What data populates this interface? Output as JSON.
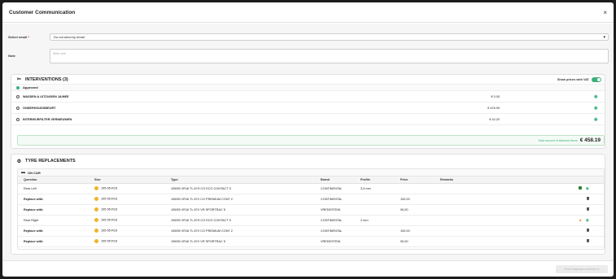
{
  "modal": {
    "title": "Customer Communication",
    "close_icon": "×"
  },
  "form": {
    "select_email_label": "Select email",
    "required_mark": "*",
    "select_email_value": "Do not send by email",
    "note_label": "Note",
    "note_placeholder": "Write note"
  },
  "interventions": {
    "title": "INTERVENTIONS (3)",
    "vat_label": "Show prices with VAT",
    "vat_on": true,
    "approved_label": "Approved",
    "items": [
      {
        "name": "WASSEN & UITZUIGEN JA/NEE",
        "price": "€ 0.00"
      },
      {
        "name": "ONDERHOUDSBEURT",
        "price": "€ 415.99"
      },
      {
        "name": "INTERIEURFILTER VERNIEUWEN",
        "price": "€ 42.20"
      }
    ],
    "total_label": "Total amount of selected items",
    "total_value": "€ 458.19"
  },
  "tyres": {
    "title": "TYRE REPLACEMENTS",
    "sub_title": "ON CAR",
    "columns": [
      "Question",
      "Size",
      "Type",
      "Brand",
      "Profile",
      "Price",
      "Remarks"
    ],
    "rows": [
      {
        "question": "Rear Left",
        "size": "195-55-R16",
        "type": "195/55 VR16 TL 87H CO ECO CONTACT 5",
        "brand": "CONTINENTAL",
        "profile": "3,3 mm",
        "price": "",
        "remarks": "",
        "bold": false,
        "icons": [
          "comment",
          "eye"
        ]
      },
      {
        "question": "Replace with:",
        "size": "195-55-R16",
        "type": "195/55 VR16 TL 87V CO PREMIUM CONT 2",
        "brand": "CONTINENTAL",
        "profile": "",
        "price": "100,00",
        "remarks": "",
        "bold": true,
        "icons": [
          "trash"
        ]
      },
      {
        "question": "Replace with:",
        "size": "195-55-R16",
        "type": "195/55 VR16 TL 87V VR SPORTRAC 5",
        "brand": "VREDESTEIN",
        "profile": "",
        "price": "90,00",
        "remarks": "",
        "bold": true,
        "icons": [
          "trash"
        ]
      },
      {
        "question": "Rear Right",
        "size": "195-55-R16",
        "type": "195/55 VR16 TL 87H CO ECO CONTACT 5",
        "brand": "CONTINENTAL",
        "profile": "2 mm",
        "price": "",
        "remarks": "",
        "bold": false,
        "icons": [
          "warning",
          "eye"
        ]
      },
      {
        "question": "Replace with:",
        "size": "195-55-R16",
        "type": "195/55 VR16 TL 87V CO PREMIUM CONT 2",
        "brand": "CONTINENTAL",
        "profile": "",
        "price": "100,00",
        "remarks": "",
        "bold": true,
        "icons": [
          "trash"
        ]
      },
      {
        "question": "Replace with:",
        "size": "195-55-R16",
        "type": "195/55 VR16 TL 87V VR SPORTRAC 5",
        "brand": "VREDESTEIN",
        "profile": "",
        "price": "90,00",
        "remarks": "",
        "bold": true,
        "icons": [
          "trash"
        ]
      }
    ]
  },
  "footer": {
    "send_label": "Send diagnose overview"
  },
  "colors": {
    "accent": "#3ab27a",
    "warning": "#f0a020",
    "tyre": "#f0b429"
  }
}
